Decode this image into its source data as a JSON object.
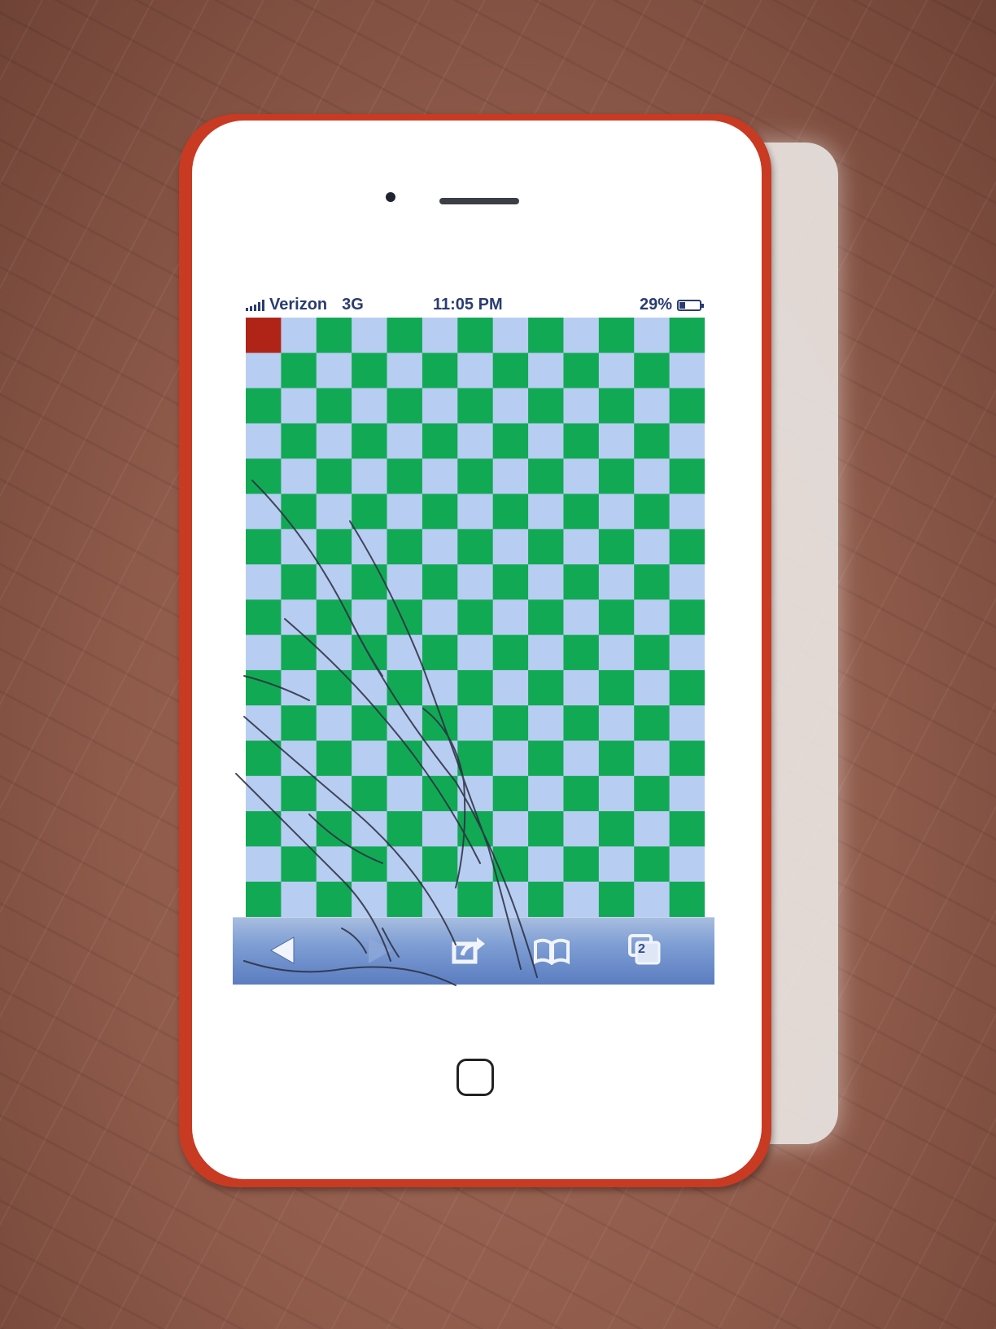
{
  "status_bar": {
    "carrier": "Verizon",
    "network": "3G",
    "time": "11:05 PM",
    "battery_percent_label": "29%",
    "battery_level": 0.29
  },
  "web_content": {
    "pattern": "checkerboard",
    "colors": {
      "green": "#12a955",
      "light": "#b8cdf2",
      "corner_marker": "#b02418"
    }
  },
  "toolbar": {
    "back_icon": "back-arrow-icon",
    "forward_icon": "forward-arrow-icon",
    "share_icon": "share-icon",
    "bookmarks_icon": "book-icon",
    "tabs_icon": "tabs-icon",
    "tabs_count": "2"
  },
  "device": {
    "case_color": "#c83a22",
    "body_color": "#ffffff"
  }
}
